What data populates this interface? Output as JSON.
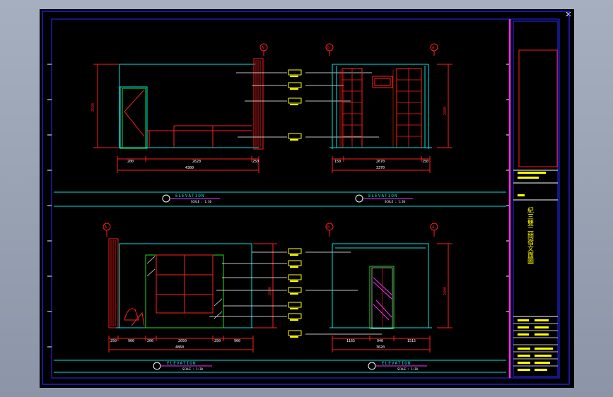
{
  "window": {
    "close_glyph": "✕"
  },
  "labels": {
    "elevation_word": "ELEVATION",
    "scale_text": "SCALE : 1:30",
    "title_block_title": "紀三雙二間宿文面圖",
    "marker_a": "A",
    "marker_b": "B"
  },
  "top_left": {
    "dims_bottom": [
      "200",
      "2620",
      "250"
    ],
    "dim_total": "4300",
    "dim_height": "2600"
  },
  "top_right": {
    "dims_bottom": [
      "150",
      "2670",
      "150"
    ],
    "dim_total": "3370",
    "dim_height": "2800"
  },
  "bottom_left": {
    "dims_bottom": [
      "250",
      "900",
      "200",
      "2050",
      "250",
      "900"
    ],
    "dim_total": "4860",
    "dim_height": "2600"
  },
  "bottom_right": {
    "dims_bottom": [
      "1165",
      "940",
      "1515"
    ],
    "dim_total": "3620",
    "dim_height": "2800"
  },
  "colors": {
    "background": "#000000",
    "frame": "#2a2aff",
    "cyan": "#00e5e5",
    "red": "#ff1e1e",
    "yellow": "#ffff00",
    "green": "#22dd22",
    "magenta": "#ff2bff",
    "white": "#ffffff"
  }
}
